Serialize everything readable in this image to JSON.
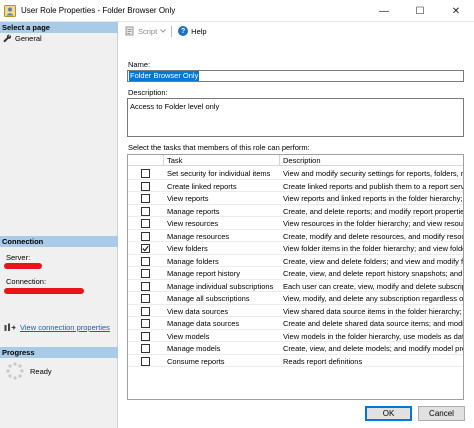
{
  "window": {
    "title": "User Role Properties - Folder Browser Only",
    "min_glyph": "—",
    "max_glyph": "☐",
    "close_glyph": "✕"
  },
  "left_panel": {
    "select_page_header": "Select a page",
    "general_label": "General",
    "connection_header": "Connection",
    "server_label": "Server:",
    "connection_label": "Connection:",
    "view_connection_link": "View connection properties",
    "progress_header": "Progress",
    "ready_label": "Ready"
  },
  "toolbar": {
    "script_label": "Script",
    "help_label": "Help",
    "help_glyph": "?"
  },
  "form": {
    "name_label": "Name:",
    "name_value": "Folder Browser Only",
    "description_label": "Description:",
    "description_value": "Access to Folder level only",
    "tasks_label": "Select the tasks that members of this role can perform:"
  },
  "tasks_table": {
    "headers": {
      "check": "",
      "task": "Task",
      "description": "Description"
    },
    "rows": [
      {
        "checked": false,
        "task": "Set security for individual items",
        "description": "View and modify security settings for reports, folders, resou"
      },
      {
        "checked": false,
        "task": "Create linked reports",
        "description": "Create linked reports and publish them to a report server fol"
      },
      {
        "checked": false,
        "task": "View reports",
        "description": "View reports and linked reports in the folder hierarchy; vie"
      },
      {
        "checked": false,
        "task": "Manage reports",
        "description": "Create, and delete reports; and modify report properties."
      },
      {
        "checked": false,
        "task": "View resources",
        "description": "View resources in the folder hierarchy; and view resource"
      },
      {
        "checked": false,
        "task": "Manage resources",
        "description": "Create, modify and delete resources, and modify resource p"
      },
      {
        "checked": true,
        "task": "View folders",
        "description": "View folder items in the folder hierarchy; and view folder p"
      },
      {
        "checked": false,
        "task": "Manage folders",
        "description": "Create, view and delete folders; and view and modify folder"
      },
      {
        "checked": false,
        "task": "Manage report history",
        "description": "Create, view, and delete report history snapshots; and modi"
      },
      {
        "checked": false,
        "task": "Manage individual subscriptions",
        "description": "Each user can create, view, modify and delete subscriptions"
      },
      {
        "checked": false,
        "task": "Manage all subscriptions",
        "description": "View, modify, and delete any subscription regardless of wh"
      },
      {
        "checked": false,
        "task": "View data sources",
        "description": "View shared data source items in the folder hierarchy; and"
      },
      {
        "checked": false,
        "task": "Manage data sources",
        "description": "Create and delete shared data source items; and modify da"
      },
      {
        "checked": false,
        "task": "View models",
        "description": "View models in the folder hierarchy, use models as data so"
      },
      {
        "checked": false,
        "task": "Manage models",
        "description": "Create, view, and delete models; and modify model proper"
      },
      {
        "checked": false,
        "task": "Consume reports",
        "description": "Reads report definitions"
      }
    ]
  },
  "buttons": {
    "ok_label": "OK",
    "cancel_label": "Cancel"
  },
  "colors": {
    "section_header_bg": "#a9cbe8",
    "selection_blue": "#0078d7",
    "redaction_red": "#e8141c",
    "link_blue": "#1a5fb4"
  }
}
